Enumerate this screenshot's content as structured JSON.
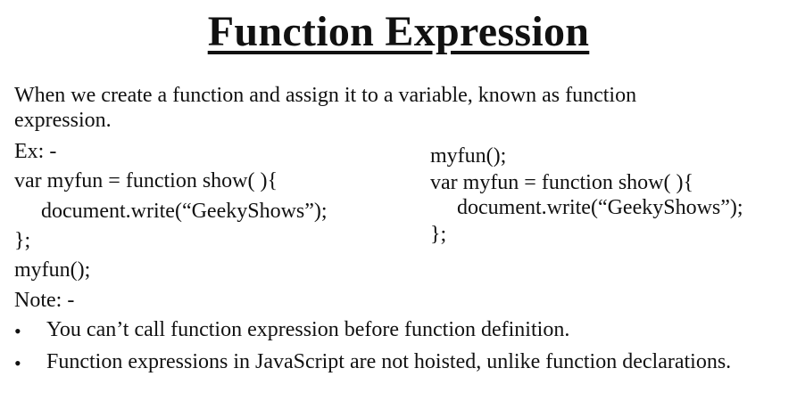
{
  "title": "Function Expression",
  "intro": {
    "line1": "When we create a function and assign it to a variable, known as function",
    "line2": "expression."
  },
  "example_label": "Ex: -",
  "left_code": [
    "var myfun = function show( ){",
    "document.write(“GeekyShows”);",
    "};",
    "myfun();"
  ],
  "right_code": [
    "myfun();",
    "var myfun = function show( ){",
    "document.write(“GeekyShows”);",
    "};"
  ],
  "note_label": "Note: -",
  "notes": [
    "You can’t call function expression before function definition.",
    "Function expressions in JavaScript are not hoisted, unlike function declarations."
  ],
  "bullet_symbol": "•"
}
